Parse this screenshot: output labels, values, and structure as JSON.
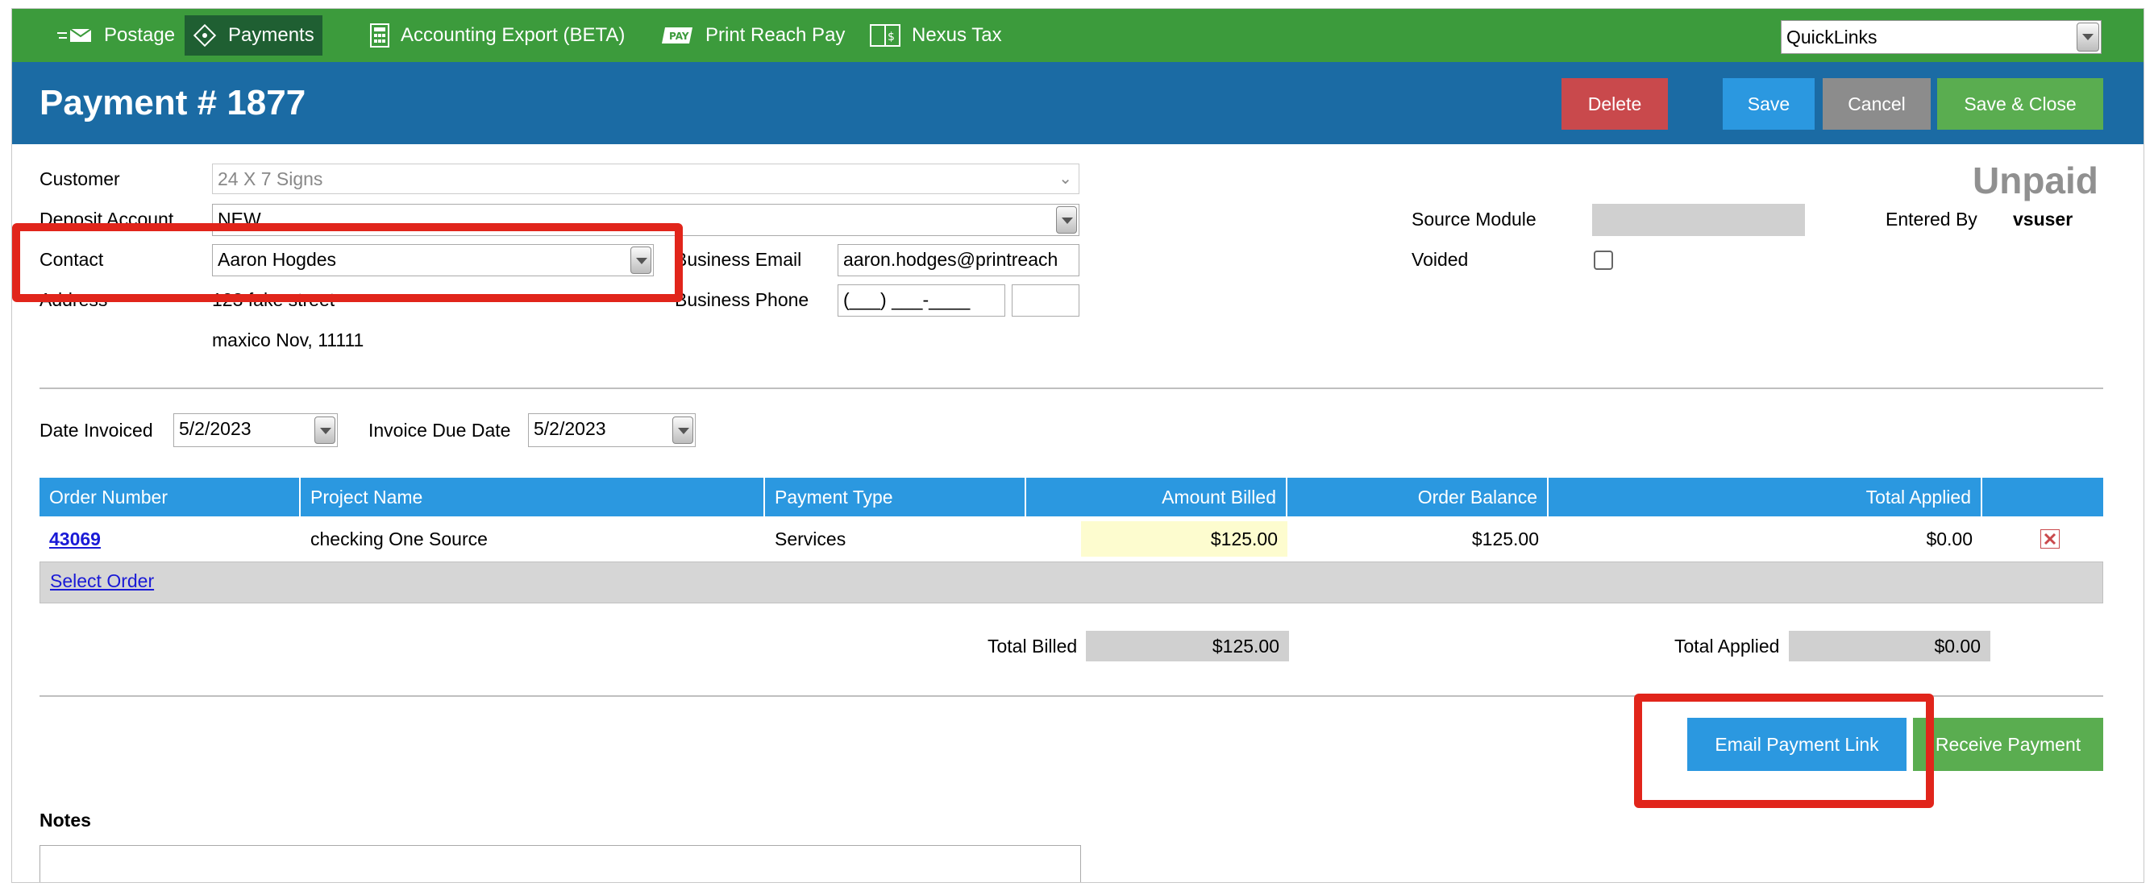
{
  "nav": {
    "items": [
      {
        "label": "Postage",
        "icon": "postage-icon"
      },
      {
        "label": "Payments",
        "icon": "payments-icon"
      },
      {
        "label": "Accounting Export (BETA)",
        "icon": "calculator-icon"
      },
      {
        "label": "Print Reach Pay",
        "icon": "pay-icon"
      },
      {
        "label": "Nexus Tax",
        "icon": "tax-icon"
      }
    ],
    "active": "Payments",
    "quicklinks": "QuickLinks"
  },
  "header": {
    "title": "Payment # 1877",
    "delete": "Delete",
    "save": "Save",
    "cancel": "Cancel",
    "save_close": "Save & Close"
  },
  "form": {
    "customer_label": "Customer",
    "customer_value": "24 X 7 Signs",
    "deposit_label": "Deposit Account",
    "deposit_value": "NEW",
    "contact_label": "Contact",
    "contact_value": "Aaron Hogdes",
    "address_label": "Address",
    "address_line1": "123 fake street",
    "address_line2": "maxico Nov, 11111",
    "email_label": "Business Email",
    "email_value": "aaron.hodges@printreach",
    "phone_label": "Business Phone",
    "phone_value": "(___) ___-____",
    "status": "Unpaid",
    "source_module_label": "Source Module",
    "entered_by_label": "Entered By",
    "entered_by_value": "vsuser",
    "voided_label": "Voided",
    "date_invoiced_label": "Date Invoiced",
    "date_invoiced_value": "5/2/2023",
    "due_date_label": "Invoice Due Date",
    "due_date_value": "5/2/2023"
  },
  "table": {
    "headers": [
      "Order Number",
      "Project Name",
      "Payment Type",
      "Amount Billed",
      "Order Balance",
      "Total Applied"
    ],
    "rows": [
      {
        "order_number": "43069",
        "project_name": "checking One Source",
        "payment_type": "Services",
        "amount_billed": "$125.00",
        "order_balance": "$125.00",
        "total_applied": "$0.00"
      }
    ],
    "select_order": "Select Order"
  },
  "totals": {
    "billed_label": "Total Billed",
    "billed_value": "$125.00",
    "applied_label": "Total Applied",
    "applied_value": "$0.00"
  },
  "actions": {
    "email_link": "Email Payment Link",
    "receive": "Receive Payment"
  },
  "notes": {
    "label": "Notes"
  },
  "colors": {
    "nav_green": "#3c9b3c",
    "title_blue": "#1b6ba4",
    "accent_blue": "#2b98e0",
    "delete_red": "#c9494c",
    "success_green": "#5aad50",
    "highlight_red": "#e1251b"
  }
}
